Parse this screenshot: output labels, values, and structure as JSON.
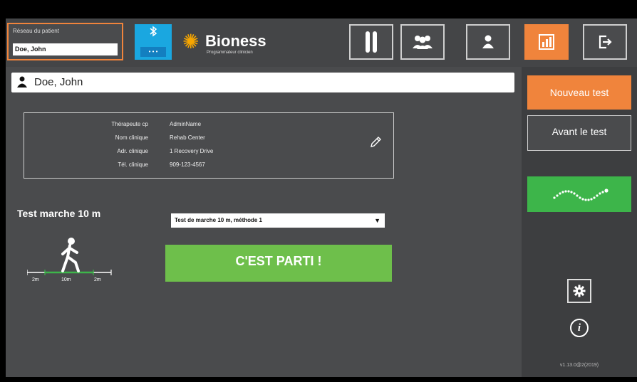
{
  "header": {
    "patient_label": "Réseau du patient",
    "patient_value": "Doe, John",
    "bluetooth_dots": "• • •",
    "logo_name": "Bioness",
    "logo_sub": "Programmateur clinicien",
    "nav": [
      {
        "name": "legs-icon",
        "active": false
      },
      {
        "name": "group-icon",
        "active": false
      },
      {
        "name": "user-icon",
        "active": false
      },
      {
        "name": "chart-icon",
        "active": true
      },
      {
        "name": "logout-icon",
        "active": false
      }
    ]
  },
  "patient_bar": {
    "name": "Doe, John"
  },
  "clinic": {
    "rows": [
      {
        "label": "Thérapeute cp",
        "value": "AdminName"
      },
      {
        "label": "Nom clinique",
        "value": "Rehab Center"
      },
      {
        "label": "Adr. clinique",
        "value": "1 Recovery Drive"
      },
      {
        "label": "Tél. clinique",
        "value": "909-123-4567"
      }
    ]
  },
  "test": {
    "title": "Test marche 10 m",
    "method_selected": "Test de marche 10 m, méthode 1",
    "go_label": "C'EST PARTI !",
    "distances": [
      "2m",
      "10m",
      "2m"
    ]
  },
  "sidebar": {
    "new_test": "Nouveau test",
    "pre_test": "Avant le test",
    "version": "v1.13.0@2(2019)"
  },
  "colors": {
    "accent": "#f0843c",
    "green": "#3db54a",
    "go": "#6ebf4b",
    "bluetooth": "#1aa7e0"
  }
}
